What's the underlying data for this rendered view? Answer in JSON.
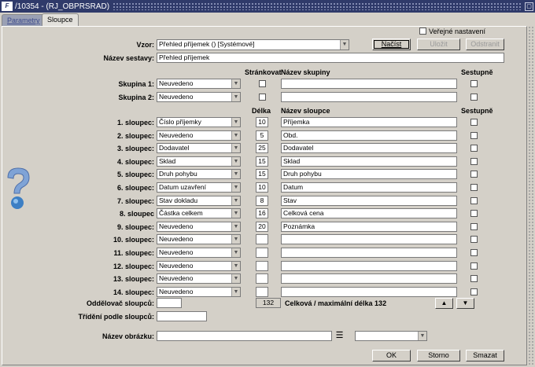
{
  "window": {
    "title": "/10354 - (RJ_OBPRSRAD)",
    "logo": "F"
  },
  "tabs": [
    {
      "label": "Parametry"
    },
    {
      "label": "Sloupce"
    }
  ],
  "form": {
    "vzor_label": "Vzor:",
    "vzor_value": "Přehled příjemek  ()  [Systémové]",
    "verejne_label": "Veřejné nastavení",
    "nacist_label": "Načíst",
    "ulozit_label": "Uložit",
    "odstranit_label": "Odstranit",
    "nazev_sestavy_label": "Název sestavy:",
    "nazev_sestavy_value": "Přehled příjemek",
    "strankovat_header": "Stránkovat",
    "nazev_skupiny_header": "Název skupiny",
    "sestupne_header": "Sestupně",
    "delka_header": "Délka",
    "nazev_sloupce_header": "Název sloupce",
    "groups": [
      {
        "label": "Skupina 1:",
        "value": "Neuvedeno"
      },
      {
        "label": "Skupina 2:",
        "value": "Neuvedeno"
      }
    ],
    "columns": [
      {
        "label": "1. sloupec:",
        "value": "Číslo příjemky",
        "length": "10",
        "name": "Příjemka"
      },
      {
        "label": "2. sloupec:",
        "value": "Neuvedeno",
        "length": "5",
        "name": "Obd."
      },
      {
        "label": "3. sloupec:",
        "value": "Dodavatel",
        "length": "25",
        "name": "Dodavatel"
      },
      {
        "label": "4. sloupec:",
        "value": "Sklad",
        "length": "15",
        "name": "Sklad"
      },
      {
        "label": "5. sloupec:",
        "value": "Druh pohybu",
        "length": "15",
        "name": "Druh pohybu"
      },
      {
        "label": "6. sloupec:",
        "value": "Datum uzavření",
        "length": "10",
        "name": "Datum"
      },
      {
        "label": "7. sloupec:",
        "value": "Stav dokladu",
        "length": "8",
        "name": "Stav"
      },
      {
        "label": "8. sloupec",
        "value": "Částka celkem",
        "length": "16",
        "name": "Celková cena"
      },
      {
        "label": "9. sloupec:",
        "value": "Neuvedeno",
        "length": "20",
        "name": "Poznámka"
      },
      {
        "label": "10. sloupec:",
        "value": "Neuvedeno",
        "length": "",
        "name": ""
      },
      {
        "label": "11. sloupec:",
        "value": "Neuvedeno",
        "length": "",
        "name": ""
      },
      {
        "label": "12. sloupec:",
        "value": "Neuvedeno",
        "length": "",
        "name": ""
      },
      {
        "label": "13. sloupec:",
        "value": "Neuvedeno",
        "length": "",
        "name": ""
      },
      {
        "label": "14. sloupec:",
        "value": "Neuvedeno",
        "length": "",
        "name": ""
      }
    ],
    "oddelovac_label": "Oddělovač sloupců:",
    "total_length_value": "132",
    "total_text": "Celková / maximální délka 132",
    "trideni_label": "Třídění podle sloupců:",
    "nazev_obrazku_label": "Název obrázku:",
    "ok_label": "OK",
    "storno_label": "Storno",
    "smazat_label": "Smazat"
  }
}
